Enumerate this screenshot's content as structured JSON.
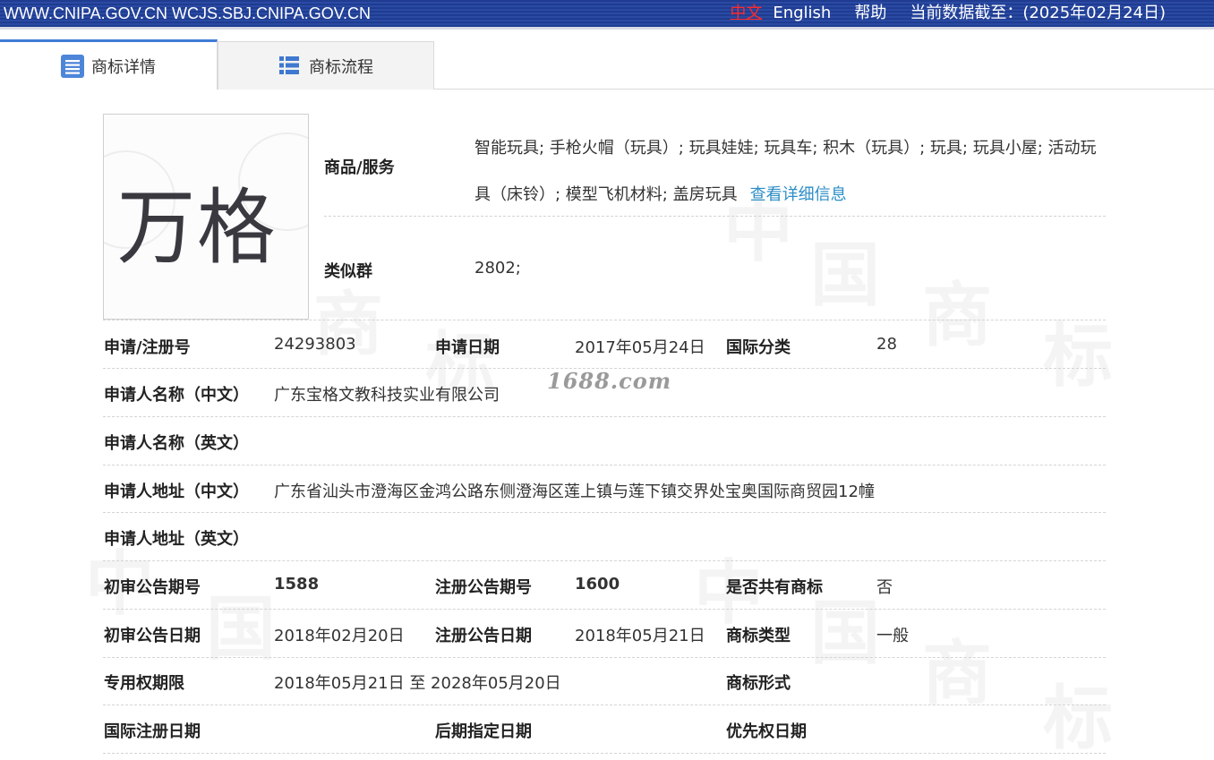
{
  "topbar": {
    "sites": "WWW.CNIPA.GOV.CN WCJS.SBJ.CNIPA.GOV.CN",
    "lang_cn": "中文",
    "lang_en": "English",
    "help": "帮助",
    "data_date": "当前数据截至：(2025年02月24日)"
  },
  "tabs": [
    {
      "label": "商标详情",
      "icon": "list-detail-icon"
    },
    {
      "label": "商标流程",
      "icon": "list-flow-icon"
    }
  ],
  "logo": {
    "text": "万格"
  },
  "goods": {
    "label": "商品/服务",
    "value": "智能玩具; 手枪火帽（玩具）; 玩具娃娃; 玩具车; 积木（玩具）; 玩具; 玩具小屋; 活动玩具（床铃）; 模型飞机材料; 盖房玩具",
    "more_link": "查看详细信息"
  },
  "similar_group": {
    "label": "类似群",
    "value": "2802;"
  },
  "fields": {
    "reg_no": {
      "label": "申请/注册号",
      "value": "24293803"
    },
    "apply_date": {
      "label": "申请日期",
      "value": "2017年05月24日"
    },
    "intl_class": {
      "label": "国际分类",
      "value": "28"
    },
    "applicant_cn": {
      "label": "申请人名称（中文）",
      "value": "广东宝格文教科技实业有限公司"
    },
    "applicant_en": {
      "label": "申请人名称（英文）",
      "value": ""
    },
    "address_cn": {
      "label": "申请人地址（中文）",
      "value": "广东省汕头市澄海区金鸿公路东侧澄海区莲上镇与莲下镇交界处宝奥国际商贸园12幢"
    },
    "address_en": {
      "label": "申请人地址（英文）",
      "value": ""
    },
    "prelim_issue": {
      "label": "初审公告期号",
      "value": "1588"
    },
    "reg_issue": {
      "label": "注册公告期号",
      "value": "1600"
    },
    "shared": {
      "label": "是否共有商标",
      "value": "否"
    },
    "prelim_date": {
      "label": "初审公告日期",
      "value": "2018年02月20日"
    },
    "reg_date": {
      "label": "注册公告日期",
      "value": "2018年05月21日"
    },
    "tm_type": {
      "label": "商标类型",
      "value": "一般"
    },
    "valid_period": {
      "label": "专用权期限",
      "value": "2018年05月21日 至 2028年05月20日"
    },
    "tm_form": {
      "label": "商标形式",
      "value": ""
    },
    "intl_reg_date": {
      "label": "国际注册日期",
      "value": ""
    },
    "later_date": {
      "label": "后期指定日期",
      "value": ""
    },
    "priority_date": {
      "label": "优先权日期",
      "value": ""
    }
  },
  "overlay_text": "1688.com",
  "colors": {
    "topbar": "#1f3c91",
    "tab_accent": "#3f7cd6",
    "link": "#2c8ec6",
    "lang_active": "#ff2a2a"
  }
}
